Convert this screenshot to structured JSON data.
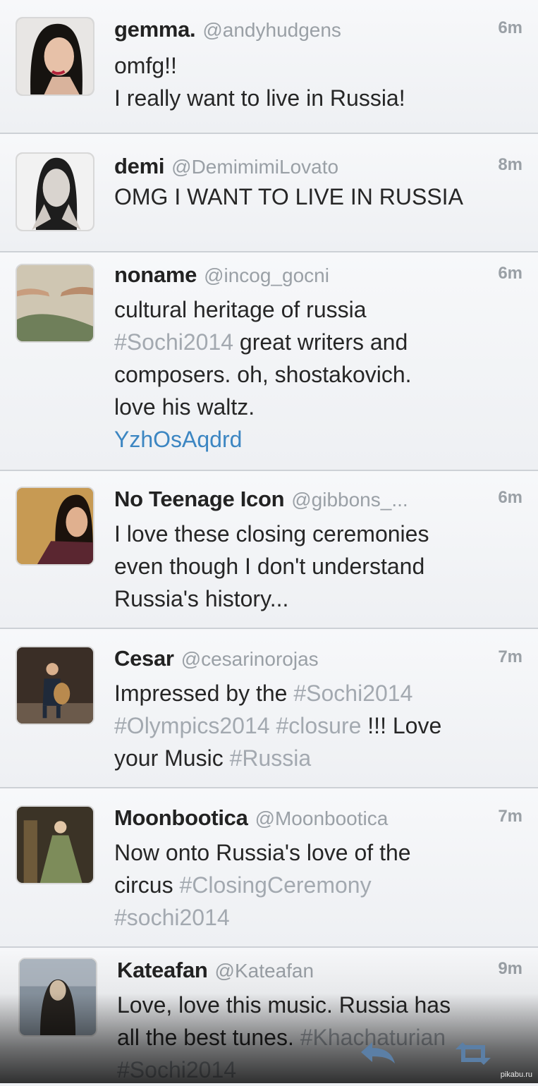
{
  "tweets": [
    {
      "name": "gemma.",
      "handle": "@andyhudgens",
      "time": "6m",
      "lines": [
        [
          {
            "t": "omfg!!",
            "k": "text"
          }
        ],
        [
          {
            "t": "I really want to live in Russia!",
            "k": "text"
          }
        ]
      ]
    },
    {
      "name": "demi",
      "handle": "@DemimimiLovato",
      "time": "8m",
      "lines": [
        [
          {
            "t": "OMG I WANT TO LIVE IN RUSSIA",
            "k": "text"
          }
        ]
      ]
    },
    {
      "name": "noname",
      "handle": "@incog_gocni",
      "time": "6m",
      "lines": [
        [
          {
            "t": "cultural heritage of russia",
            "k": "text"
          }
        ],
        [
          {
            "t": "#Sochi2014",
            "k": "tag"
          },
          {
            "t": " great writers and",
            "k": "text"
          }
        ],
        [
          {
            "t": "composers. oh, shostakovich.",
            "k": "text"
          }
        ],
        [
          {
            "t": "love his waltz.",
            "k": "text"
          }
        ],
        [
          {
            "t": "YzhOsAqdrd",
            "k": "link"
          }
        ]
      ]
    },
    {
      "name": "No Teenage Icon",
      "handle": "@gibbons_...",
      "time": "6m",
      "lines": [
        [
          {
            "t": "I love these closing ceremonies",
            "k": "text"
          }
        ],
        [
          {
            "t": "even though I don't understand",
            "k": "text"
          }
        ],
        [
          {
            "t": "Russia's history...",
            "k": "text"
          }
        ]
      ]
    },
    {
      "name": "Cesar",
      "handle": "@cesarinorojas",
      "time": "7m",
      "lines": [
        [
          {
            "t": "Impressed by the ",
            "k": "text"
          },
          {
            "t": "#Sochi2014",
            "k": "tag"
          }
        ],
        [
          {
            "t": "#Olympics2014 #closure",
            "k": "tag"
          },
          {
            "t": " !!! Love",
            "k": "text"
          }
        ],
        [
          {
            "t": "your Music ",
            "k": "text"
          },
          {
            "t": "#Russia",
            "k": "tag"
          }
        ]
      ]
    },
    {
      "name": "Moonbootica",
      "handle": "@Moonbootica",
      "time": "7m",
      "lines": [
        [
          {
            "t": "Now onto Russia's love of the",
            "k": "text"
          }
        ],
        [
          {
            "t": "circus ",
            "k": "text"
          },
          {
            "t": "#ClosingCeremony",
            "k": "tag"
          }
        ],
        [
          {
            "t": "#sochi2014",
            "k": "tag"
          }
        ]
      ]
    },
    {
      "name": "Kateafan",
      "handle": "@Kateafan",
      "time": "9m",
      "lines": [
        [
          {
            "t": "Love, love this music. Russia has",
            "k": "text"
          }
        ],
        [
          {
            "t": "all the best tunes. ",
            "k": "text"
          },
          {
            "t": "#Khachaturian",
            "k": "tag"
          }
        ],
        [
          {
            "t": "#Sochi2014",
            "k": "tag"
          }
        ]
      ]
    }
  ],
  "toolbar": {
    "reply_icon": "reply-arrow-icon",
    "retweet_icon": "retweet-icon"
  },
  "watermark": "pikabu.ru",
  "colors": {
    "hashtag": "#a3a9b0",
    "link": "#3c86c2",
    "handle": "#9aa0a6"
  }
}
